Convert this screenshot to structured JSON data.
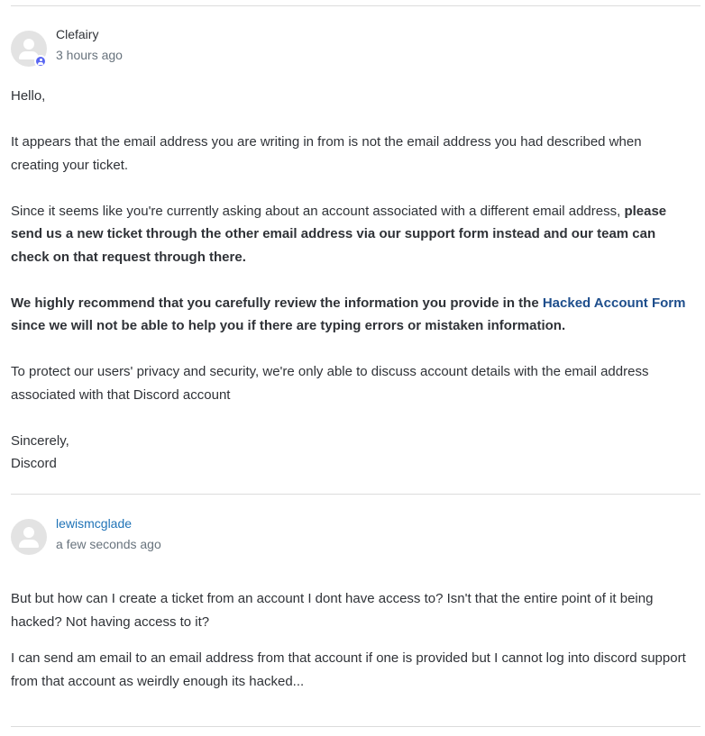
{
  "comments": [
    {
      "author": "Clefairy",
      "time": "3 hours ago",
      "is_agent": true,
      "paragraphs": {
        "greeting": "Hello,",
        "p1": "It appears that the email address you are writing in from is not the email address you had described when creating your ticket.",
        "p2_plain": "Since it seems like you're currently asking about an account associated with a different email address, ",
        "p2_bold": "please send us a new ticket through the other email address via our support form instead and our team can check on that request through there.",
        "p3_bold_start": "We highly recommend that you carefully review the information you provide in the ",
        "p3_link": "Hacked Account Form",
        "p3_bold_end": " since we will not be able to help you if there are typing errors or mistaken information.",
        "p4": "To protect our users' privacy and security, we're only able to discuss account details with the email address associated with that Discord account",
        "signoff_1": "Sincerely,",
        "signoff_2": "Discord"
      }
    },
    {
      "author": "lewismcglade",
      "time": "a few seconds ago",
      "is_agent": false,
      "paragraphs": {
        "p1": "But but how can I create a ticket from an account I dont have access to? Isn't that the entire point of it being hacked? Not having access to it?",
        "p2": "I can send am email to an email address from that account if one is provided but I cannot log into discord support from that account as weirdly enough its hacked..."
      }
    }
  ]
}
